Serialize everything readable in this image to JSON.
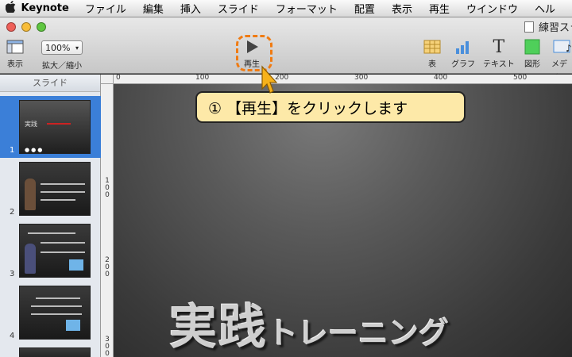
{
  "menubar": {
    "app": "Keynote",
    "items": [
      "ファイル",
      "編集",
      "挿入",
      "スライド",
      "フォーマット",
      "配置",
      "表示",
      "再生",
      "ウインドウ",
      "ヘル"
    ]
  },
  "window": {
    "title": "練習スラ"
  },
  "toolbar": {
    "view_label": "表示",
    "zoom_value": "100%",
    "zoom_label": "拡大／縮小",
    "play_label": "再生",
    "table_label": "表",
    "chart_label": "グラフ",
    "text_label": "テキスト",
    "shape_label": "図形",
    "media_label": "メディ"
  },
  "sidebar": {
    "header": "スライド",
    "slides": [
      {
        "number": "1",
        "selected": true
      },
      {
        "number": "2",
        "selected": false
      },
      {
        "number": "3",
        "selected": false
      },
      {
        "number": "4",
        "selected": false
      }
    ]
  },
  "ruler": {
    "top": [
      "0",
      "100",
      "200",
      "300",
      "400",
      "500"
    ],
    "left": [
      "100",
      "200",
      "300"
    ]
  },
  "slide": {
    "title_big": "実践",
    "title_small": "トレーニング"
  },
  "callout": {
    "text": "① 【再生】をクリックします"
  },
  "colors": {
    "highlight": "#f07b12",
    "callout_bg": "#fde9a8",
    "selection": "#3b7fd8"
  }
}
